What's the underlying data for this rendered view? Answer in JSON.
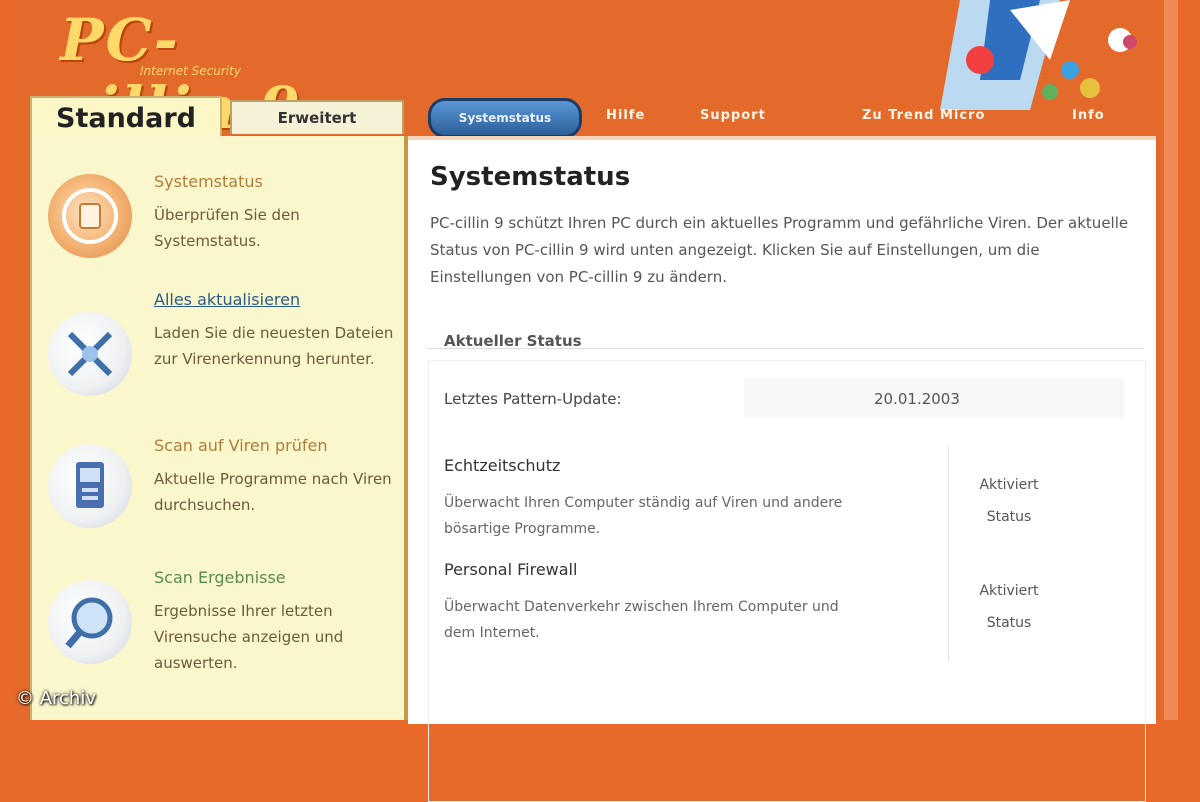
{
  "app": {
    "logo_text": "PC-cillin 9",
    "logo_subtitle": "Internet Security"
  },
  "tabs": {
    "standard": "Standard",
    "erweitert": "Erweitert"
  },
  "nav": {
    "active": "Systemstatus",
    "links": [
      "Hilfe",
      "Support",
      "Zu Trend Micro",
      "Info"
    ]
  },
  "sidebar": {
    "items": [
      {
        "title": "Systemstatus",
        "desc": "Überprüfen Sie den Systemstatus."
      },
      {
        "title": "Alles aktualisieren",
        "desc": "Laden Sie die neuesten Dateien zur Virenerkennung herunter."
      },
      {
        "title": "Scan auf Viren prüfen",
        "desc": "Aktuelle Programme nach Viren durchsuchen."
      },
      {
        "title": "Scan Ergebnisse",
        "desc": "Ergebnisse Ihrer letzten Virensuche anzeigen und auswerten."
      }
    ]
  },
  "main": {
    "title": "Systemstatus",
    "intro": "PC-cillin 9 schützt Ihren PC durch ein aktuelles Programm und gefährliche Viren. Der aktuelle Status von PC-cillin 9 wird unten angezeigt. Klicken Sie auf Einstellungen, um die Einstellungen von PC-cillin 9 zu ändern.",
    "section_label": "Aktueller Status",
    "last_update_label": "Letztes Pattern-Update:",
    "last_update_value": "20.01.2003",
    "rows": [
      {
        "title": "Echtzeitschutz",
        "desc": "Überwacht Ihren Computer ständig auf Viren und andere bösartige Programme.",
        "status_line1": "Aktiviert",
        "status_line2": "Status"
      },
      {
        "title": "Personal Firewall",
        "desc": "Überwacht Datenverkehr zwischen Ihrem Computer und dem Internet.",
        "status_line1": "Aktiviert",
        "status_line2": "Status"
      }
    ]
  },
  "credit": "© Archiv",
  "colors": {
    "frame": "#e36a2b",
    "sidebar": "#fbf7cc",
    "nav_pill": "#2c5f9a"
  }
}
